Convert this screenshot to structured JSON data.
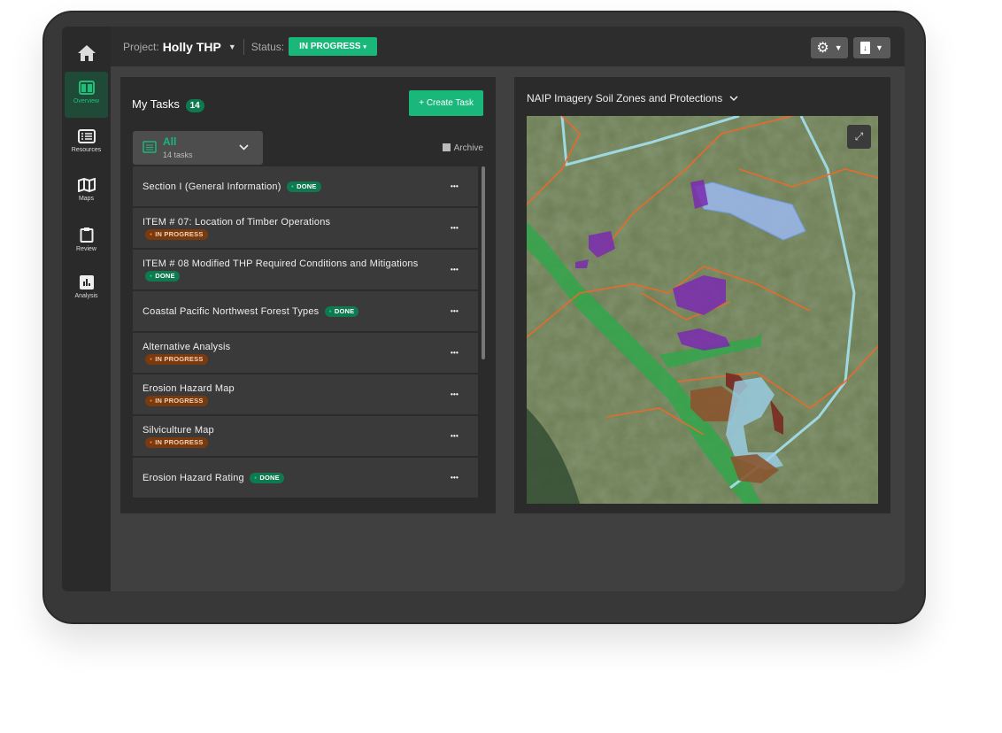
{
  "header": {
    "project_label": "Project:",
    "project_name": "Holly THP",
    "status_label": "Status:",
    "status_value": "IN PROGRESS"
  },
  "sidebar": {
    "items": [
      {
        "label": "Overview",
        "icon": "overview-icon",
        "active": true
      },
      {
        "label": "Resources",
        "icon": "list-icon"
      },
      {
        "label": "Maps",
        "icon": "map-icon"
      },
      {
        "label": "Review",
        "icon": "clipboard-icon"
      },
      {
        "label": "Analysis",
        "icon": "chart-icon"
      }
    ]
  },
  "tasks": {
    "title": "My Tasks",
    "count": "14",
    "create_label": "+ Create Task",
    "filter_label": "All",
    "filter_count": "14 tasks",
    "archive_label": "Archive",
    "items": [
      {
        "title": "Section I (General Information)",
        "status": "DONE"
      },
      {
        "title": "ITEM # 07: Location of Timber Operations",
        "status": "IN PROGRESS"
      },
      {
        "title": "ITEM # 08 Modified THP Required Conditions and Mitigations",
        "status": "DONE"
      },
      {
        "title": "Coastal Pacific Northwest Forest Types",
        "status": "DONE"
      },
      {
        "title": "Alternative Analysis",
        "status": "IN PROGRESS"
      },
      {
        "title": "Erosion Hazard Map",
        "status": "IN PROGRESS"
      },
      {
        "title": "Silviculture Map",
        "status": "IN PROGRESS"
      },
      {
        "title": "Erosion Hazard Rating",
        "status": "DONE"
      }
    ]
  },
  "map": {
    "title": "NAIP Imagery Soil Zones and Protections"
  },
  "colors": {
    "accent": "#19b77a",
    "done": "#0f7a4f",
    "in_progress": "#7a3a10"
  }
}
